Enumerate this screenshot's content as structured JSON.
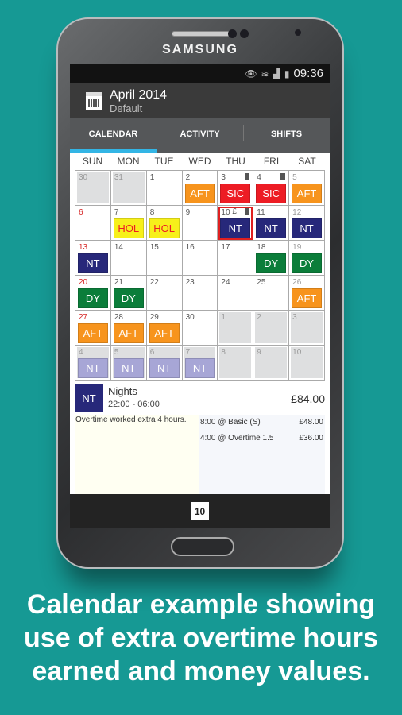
{
  "device": {
    "brand": "SAMSUNG"
  },
  "status_bar": {
    "time": "09:36",
    "icons": [
      "eye-icon",
      "wifi-icon",
      "signal-icon",
      "battery-icon"
    ]
  },
  "action_bar": {
    "title": "April 2014",
    "subtitle": "Default"
  },
  "tabs": [
    {
      "label": "CALENDAR",
      "active": true
    },
    {
      "label": "ACTIVITY",
      "active": false
    },
    {
      "label": "SHIFTS",
      "active": false
    }
  ],
  "weekdays": [
    "SUN",
    "MON",
    "TUE",
    "WED",
    "THU",
    "FRI",
    "SAT"
  ],
  "colors": {
    "AFT": "#f7941d",
    "SIC": "#ed1c24",
    "HOL": "#f7f01a",
    "NT": "#27287a",
    "DY": "#0b7d3a",
    "NT_faded": "#a7a6d6",
    "tab_indicator": "#33b5e5",
    "background": "#169994"
  },
  "calendar": [
    {
      "day": "30",
      "other": true
    },
    {
      "day": "31",
      "other": true
    },
    {
      "day": "1"
    },
    {
      "day": "2",
      "shift": "AFT"
    },
    {
      "day": "3",
      "shift": "SIC",
      "note": true
    },
    {
      "day": "4",
      "shift": "SIC",
      "note": true
    },
    {
      "day": "5",
      "shift": "AFT"
    },
    {
      "day": "6"
    },
    {
      "day": "7",
      "shift": "HOL"
    },
    {
      "day": "8",
      "shift": "HOL"
    },
    {
      "day": "9"
    },
    {
      "day": "10",
      "shift": "NT",
      "note": true,
      "money": "£",
      "selected": true
    },
    {
      "day": "11",
      "shift": "NT"
    },
    {
      "day": "12",
      "shift": "NT"
    },
    {
      "day": "13",
      "shift": "NT"
    },
    {
      "day": "14"
    },
    {
      "day": "15"
    },
    {
      "day": "16"
    },
    {
      "day": "17"
    },
    {
      "day": "18",
      "shift": "DY"
    },
    {
      "day": "19",
      "shift": "DY"
    },
    {
      "day": "20",
      "shift": "DY"
    },
    {
      "day": "21",
      "shift": "DY"
    },
    {
      "day": "22"
    },
    {
      "day": "23"
    },
    {
      "day": "24"
    },
    {
      "day": "25"
    },
    {
      "day": "26",
      "shift": "AFT"
    },
    {
      "day": "27",
      "shift": "AFT"
    },
    {
      "day": "28",
      "shift": "AFT"
    },
    {
      "day": "29",
      "shift": "AFT"
    },
    {
      "day": "30"
    },
    {
      "day": "1",
      "other": true
    },
    {
      "day": "2",
      "other": true
    },
    {
      "day": "3",
      "other": true
    },
    {
      "day": "4",
      "other": true,
      "shift": "NT",
      "faded": true
    },
    {
      "day": "5",
      "other": true,
      "shift": "NT",
      "faded": true
    },
    {
      "day": "6",
      "other": true,
      "shift": "NT",
      "faded": true
    },
    {
      "day": "7",
      "other": true,
      "shift": "NT",
      "faded": true
    },
    {
      "day": "8",
      "other": true
    },
    {
      "day": "9",
      "other": true
    },
    {
      "day": "10",
      "other": true
    }
  ],
  "detail": {
    "code": "NT",
    "name": "Nights",
    "time": "22:00 - 06:00",
    "total": "£84.00",
    "note": "Overtime worked extra 4 hours.",
    "pay": [
      {
        "label": "8:00 @ Basic (S)",
        "amount": "£48.00"
      },
      {
        "label": "4:00 @ Overtime 1.5",
        "amount": "£36.00"
      }
    ]
  },
  "nav": {
    "today": "10"
  },
  "caption": [
    "Calendar example showing",
    "use of extra overtime hours",
    "earned and money values."
  ]
}
